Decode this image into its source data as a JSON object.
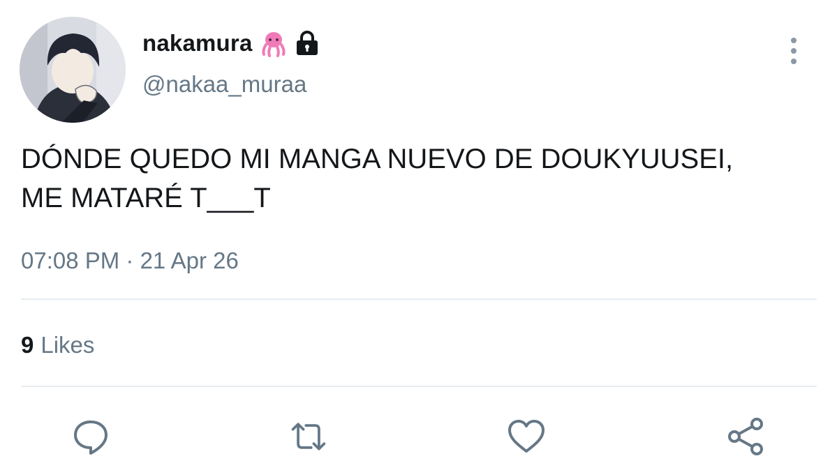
{
  "user": {
    "display_name": "nakamura",
    "handle": "@nakaa_muraa",
    "badges": [
      "octopus-emoji",
      "lock-icon"
    ]
  },
  "tweet": {
    "text": "DÓNDE QUEDO MI MANGA NUEVO DE DOUKYUUSEI,\nME MATARÉ T___T",
    "timestamp": "07:08 PM · 21 Apr 26"
  },
  "stats": {
    "likes_count": "9",
    "likes_label": "Likes"
  },
  "actions": [
    {
      "icon": "reply-icon"
    },
    {
      "icon": "retweet-icon"
    },
    {
      "icon": "like-icon"
    },
    {
      "icon": "share-icon"
    }
  ],
  "colors": {
    "text_primary": "#14171a",
    "text_secondary": "#657786",
    "icon_gray": "#8b98a5",
    "divider": "#e6ecf0"
  }
}
